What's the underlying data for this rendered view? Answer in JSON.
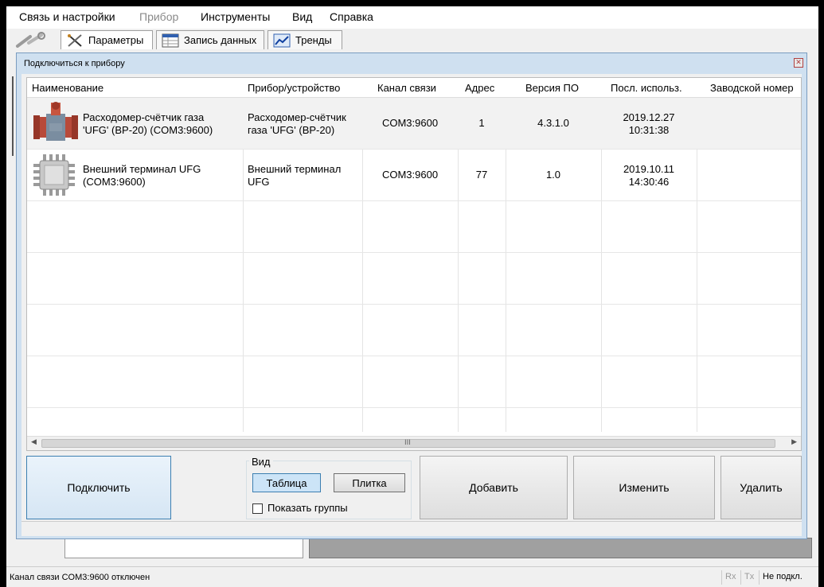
{
  "menu": {
    "items": [
      {
        "label": "Связь и настройки",
        "enabled": true
      },
      {
        "label": "Прибор",
        "enabled": false
      },
      {
        "label": "Инструменты",
        "enabled": true
      },
      {
        "label": "Вид",
        "enabled": true
      },
      {
        "label": "Справка",
        "enabled": true
      }
    ]
  },
  "toolbar": {
    "tabs": [
      {
        "label": "Параметры",
        "icon": "tools-icon",
        "active": true
      },
      {
        "label": "Запись данных",
        "icon": "table-icon",
        "active": false
      },
      {
        "label": "Тренды",
        "icon": "chart-icon",
        "active": false
      }
    ]
  },
  "dialog": {
    "title": "Подключиться к прибору",
    "columns": [
      "Наименование",
      "Прибор/устройство",
      "Канал связи",
      "Адрес",
      "Версия ПО",
      "Посл. использ.",
      "Заводской номер"
    ],
    "rows": [
      {
        "icon": "flowmeter-icon",
        "name_line1": "Расходомер-счётчик газа",
        "name_line2": "'UFG' (BP-20) (COM3:9600)",
        "device_line1": "Расходомер-счётчик",
        "device_line2": "газа 'UFG' (BP-20)",
        "channel": "COM3:9600",
        "address": "1",
        "version": "4.3.1.0",
        "last_date": "2019.12.27",
        "last_time": "10:31:38",
        "serial": ""
      },
      {
        "icon": "chip-icon",
        "name_line1": "Внешний терминал UFG",
        "name_line2": "(COM3:9600)",
        "device_line1": "Внешний терминал",
        "device_line2": "UFG",
        "channel": "COM3:9600",
        "address": "77",
        "version": "1.0",
        "last_date": "2019.10.11",
        "last_time": "14:30:46",
        "serial": ""
      }
    ],
    "scroll_grip": "III",
    "buttons": {
      "connect": "Подключить",
      "add": "Добавить",
      "edit": "Изменить",
      "delete": "Удалить"
    },
    "view": {
      "label": "Вид",
      "table": "Таблица",
      "tiles": "Плитка",
      "selected": "Таблица",
      "show_groups": "Показать группы",
      "show_groups_checked": false
    }
  },
  "status": {
    "text": "Канал связи COM3:9600 отключен",
    "rx": "Rx",
    "tx": "Tx",
    "state": "Не подкл."
  }
}
